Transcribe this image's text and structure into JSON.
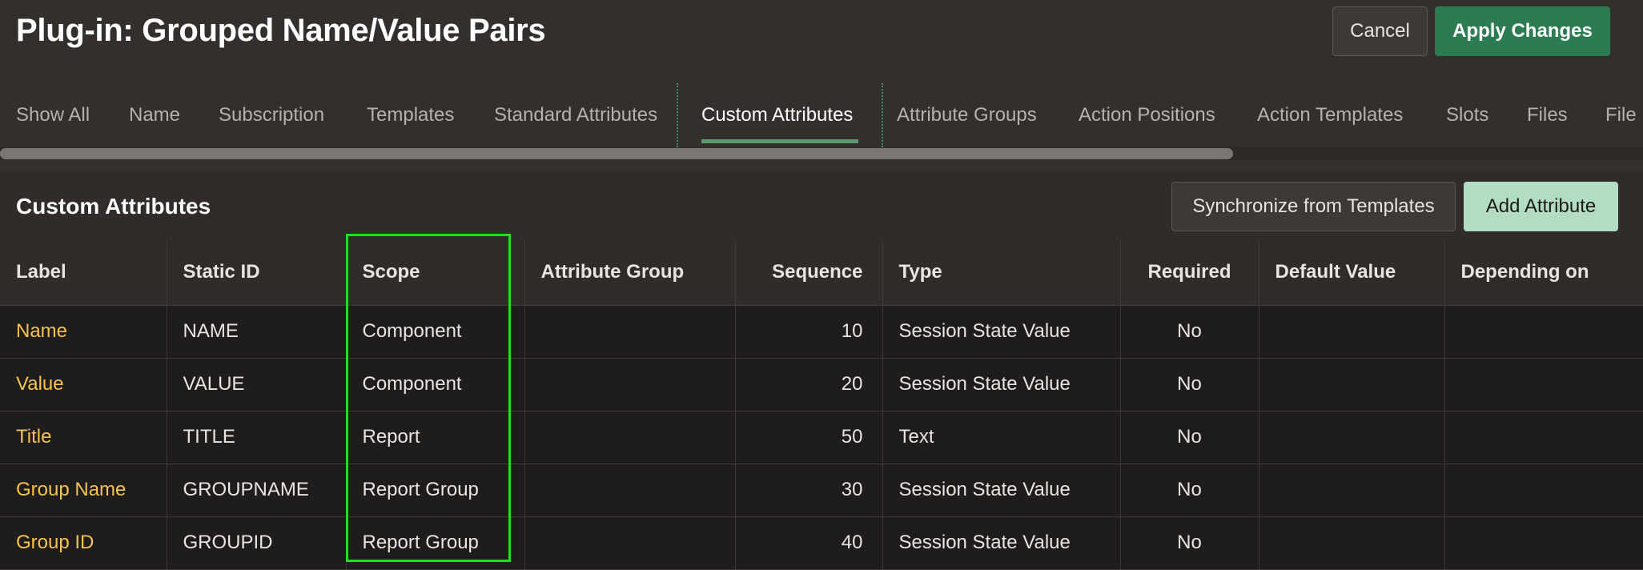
{
  "header": {
    "title": "Plug-in: Grouped Name/Value Pairs",
    "cancel_label": "Cancel",
    "apply_label": "Apply Changes"
  },
  "tabs": [
    {
      "label": "Show All"
    },
    {
      "label": "Name"
    },
    {
      "label": "Subscription"
    },
    {
      "label": "Templates"
    },
    {
      "label": "Standard Attributes"
    },
    {
      "label": "Custom Attributes",
      "active": true
    },
    {
      "label": "Attribute Groups"
    },
    {
      "label": "Action Positions"
    },
    {
      "label": "Action Templates"
    },
    {
      "label": "Slots"
    },
    {
      "label": "Files"
    },
    {
      "label": "File"
    }
  ],
  "region": {
    "title": "Custom Attributes",
    "sync_label": "Synchronize from Templates",
    "add_label": "Add Attribute"
  },
  "table": {
    "columns": [
      "Label",
      "Static ID",
      "Scope",
      "Attribute Group",
      "Sequence",
      "Type",
      "Required",
      "Default Value",
      "Depending on"
    ],
    "rows": [
      {
        "label": "Name",
        "static_id": "NAME",
        "scope": "Component",
        "group": "",
        "sequence": "10",
        "type": "Session State Value",
        "required": "No",
        "default": "",
        "depending": ""
      },
      {
        "label": "Value",
        "static_id": "VALUE",
        "scope": "Component",
        "group": "",
        "sequence": "20",
        "type": "Session State Value",
        "required": "No",
        "default": "",
        "depending": ""
      },
      {
        "label": "Title",
        "static_id": "TITLE",
        "scope": "Report",
        "group": "",
        "sequence": "50",
        "type": "Text",
        "required": "No",
        "default": "",
        "depending": ""
      },
      {
        "label": "Group Name",
        "static_id": "GROUPNAME",
        "scope": "Report Group",
        "group": "",
        "sequence": "30",
        "type": "Session State Value",
        "required": "No",
        "default": "",
        "depending": ""
      },
      {
        "label": "Group ID",
        "static_id": "GROUPID",
        "scope": "Report Group",
        "group": "",
        "sequence": "40",
        "type": "Session State Value",
        "required": "No",
        "default": "",
        "depending": ""
      }
    ]
  },
  "colors": {
    "accent": "#2c7c52",
    "link": "#f6c34f",
    "highlight": "#1ee01e"
  }
}
